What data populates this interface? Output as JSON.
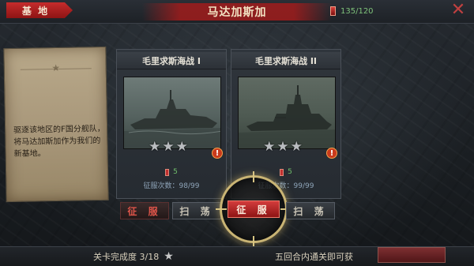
{
  "header": {
    "base_label": "基 地",
    "title": "马达加斯加",
    "energy": "135/120",
    "close_icon": "close-icon"
  },
  "briefing": {
    "text": "驱逐该地区的F国分舰队，将马达加斯加作为我们的新基地。"
  },
  "missions": [
    {
      "title": "毛里求斯海战 I",
      "stars": [
        "★",
        "★",
        "★"
      ],
      "cost": "5",
      "conquer_count": "征服次数：98/99"
    },
    {
      "title": "毛里求斯海战 II",
      "stars": [
        "★",
        "★",
        "★"
      ],
      "cost": "5",
      "conquer_count": "征服次数：99/99"
    }
  ],
  "buttons": {
    "conquer": "征 服",
    "sweep": "扫 荡",
    "conquer_main": "征 服",
    "sweep_2": "扫 荡"
  },
  "footer": {
    "progress": "关卡完成度 3/18",
    "progress_star": "★",
    "reward": "五回合内通关即可获"
  },
  "colors": {
    "accent_red": "#c52c2c",
    "energy_green": "#7ec27a",
    "ring_gold": "#c9b474"
  }
}
